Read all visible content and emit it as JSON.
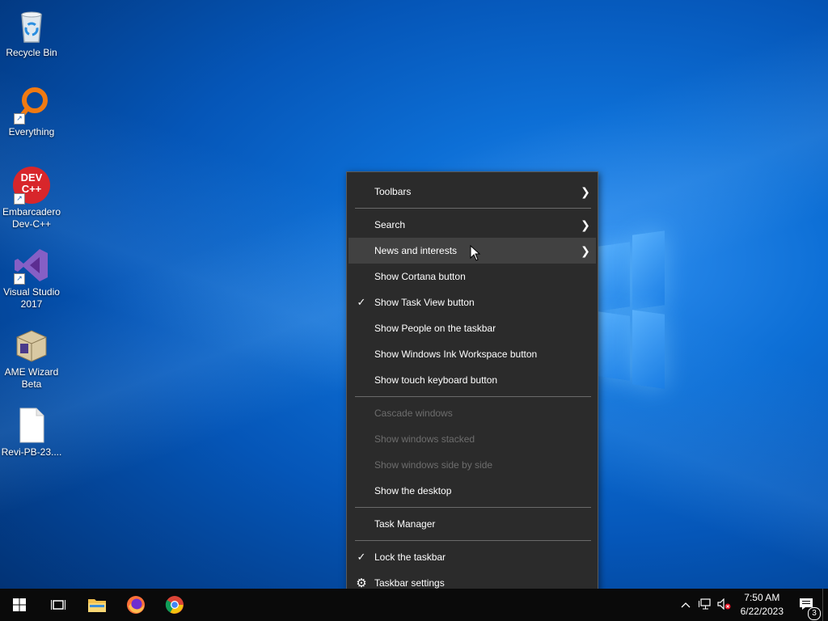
{
  "desktop": {
    "icons": [
      {
        "label": "Recycle Bin"
      },
      {
        "label": "Everything"
      },
      {
        "label": "Embarcadero Dev-C++",
        "logo_text": "DEV C++"
      },
      {
        "label": "Visual Studio 2017"
      },
      {
        "label": "AME Wizard Beta"
      },
      {
        "label": "Revi-PB-23...."
      }
    ]
  },
  "menu": {
    "items": [
      {
        "label": "Toolbars",
        "submenu": true
      },
      {
        "label": "Search",
        "submenu": true
      },
      {
        "label": "News and interests",
        "submenu": true,
        "hover": true
      },
      {
        "label": "Show Cortana button"
      },
      {
        "label": "Show Task View button",
        "checked": true
      },
      {
        "label": "Show People on the taskbar"
      },
      {
        "label": "Show Windows Ink Workspace button"
      },
      {
        "label": "Show touch keyboard button"
      },
      {
        "label": "Cascade windows",
        "disabled": true
      },
      {
        "label": "Show windows stacked",
        "disabled": true
      },
      {
        "label": "Show windows side by side",
        "disabled": true
      },
      {
        "label": "Show the desktop"
      },
      {
        "label": "Task Manager"
      },
      {
        "label": "Lock the taskbar",
        "checked": true
      },
      {
        "label": "Taskbar settings",
        "icon": "gear-icon"
      }
    ],
    "check_glyph": "✓",
    "arrow_glyph": "❯",
    "gear_glyph": "⚙"
  },
  "taskbar": {
    "pinned": [
      "start-icon",
      "task-view-icon",
      "file-explorer-icon",
      "firefox-icon",
      "chrome-icon"
    ],
    "clock": {
      "time": "7:50 AM",
      "date": "6/22/2023"
    },
    "notification_count": "3"
  },
  "colors": {
    "menu_bg": "#2b2b2b",
    "menu_hover": "#414141",
    "disabled_text": "#6d6d6d",
    "taskbar_bg": "#0a0a0a"
  }
}
